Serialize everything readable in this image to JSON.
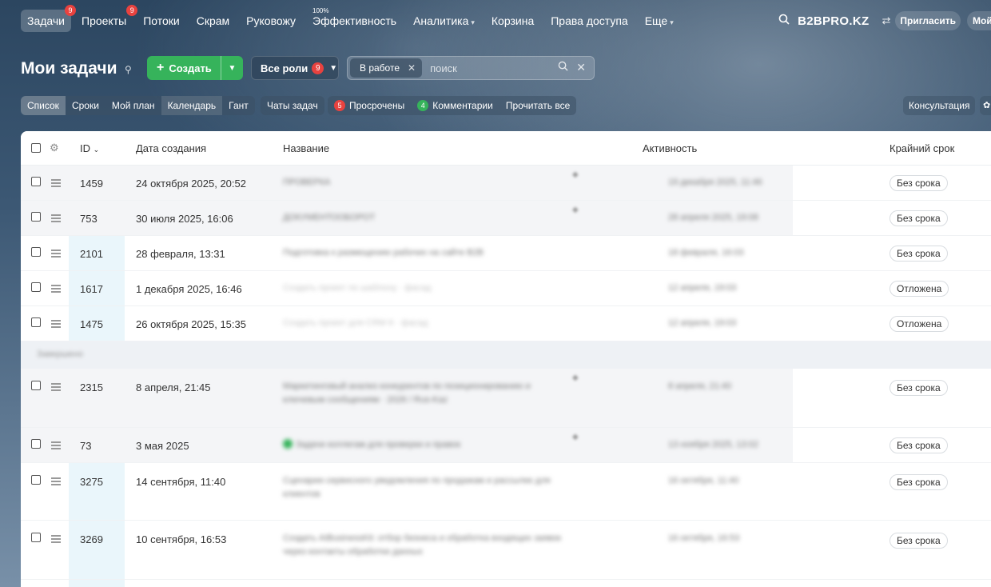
{
  "nav": {
    "items": [
      {
        "label": "Задачи",
        "badge": "9",
        "active": true
      },
      {
        "label": "Проекты",
        "badge": "9"
      },
      {
        "label": "Потоки"
      },
      {
        "label": "Скрам"
      },
      {
        "label": "Руковожу"
      },
      {
        "label": "Эффективность",
        "sup": "100%"
      },
      {
        "label": "Аналитика",
        "dropdown": true
      },
      {
        "label": "Корзина"
      },
      {
        "label": "Права доступа"
      },
      {
        "label": "Еще",
        "dropdown": true
      }
    ],
    "brand": "B2BPRO.KZ",
    "invite_label": "Пригласить",
    "my_label": "Мой"
  },
  "header": {
    "title": "Мои задачи",
    "create_label": "Создать",
    "roles_label": "Все роли",
    "roles_badge": "9",
    "filter_chip": "В работе",
    "search_placeholder": "поиск"
  },
  "toolbar": {
    "views": [
      "Список",
      "Сроки",
      "Мой план",
      "Календарь",
      "Гант"
    ],
    "active_view": "Список",
    "chats_label": "Чаты задач",
    "overdue_count": "5",
    "overdue_label": "Просрочены",
    "comments_count": "4",
    "comments_label": "Комментарии",
    "read_all_label": "Прочитать все",
    "consult_label": "Консультация"
  },
  "table": {
    "columns": {
      "id": "ID",
      "created": "Дата создания",
      "name": "Название",
      "activity": "Активность",
      "deadline": "Крайний срок"
    },
    "rows": [
      {
        "id": "1459",
        "created": "24 октября 2025, 20:52",
        "name": "ПРОВЕРКА",
        "activity": "19 декабря 2025, 11:46",
        "deadline": "Без срока"
      },
      {
        "id": "753",
        "created": "30 июля 2025, 16:06",
        "name": "ДОКУМЕНТООБОРОТ",
        "activity": "28 апреля 2025, 19:08",
        "deadline": "Без срока"
      },
      {
        "id": "2101",
        "created": "28 февраля, 13:31",
        "name": "Подготовка к размещению рабочих на сайте B2B",
        "activity": "18 февраля, 16:03",
        "deadline": "Без срока"
      },
      {
        "id": "1617",
        "created": "1 декабря 2025, 16:46",
        "name": "Создать проект по шаблону · фасад",
        "activity": "12 апреля, 19:03",
        "deadline": "Отложена"
      },
      {
        "id": "1475",
        "created": "26 октября 2025, 15:35",
        "name": "Создать проект для CRM 6 · фасад",
        "activity": "12 апреля, 19:03",
        "deadline": "Отложена"
      },
      {
        "id": "2315",
        "created": "8 апреля, 21:45",
        "name": "Маркетинговый анализ конкурентов по позиционированию и ключевым сообщениям · 2026 / Rus-Kaz",
        "activity": "8 апреля, 21:40",
        "deadline": "Без срока"
      },
      {
        "id": "73",
        "created": "3 мая 2025",
        "name": "Задачи коллегам для проверки и правок",
        "activity": "13 ноября 2025, 13:02",
        "deadline": "Без срока"
      },
      {
        "id": "3275",
        "created": "14 сентября, 11:40",
        "name": "Сценарии сервисного уведомления по продажам и рассылке для клиентов",
        "activity": "16 октября, 11:40",
        "deadline": "Без срока"
      },
      {
        "id": "3269",
        "created": "10 сентября, 16:53",
        "name": "Создать AIBusinessKit: отбор бизнеса и обработка входящих заявок через контакты обработки данных",
        "activity": "16 октября, 16:53",
        "deadline": "Без срока"
      }
    ],
    "group_label": "Завершено"
  },
  "colors": {
    "accent_green": "#36b35b",
    "badge_red": "#e8423f",
    "id_column": "#eaf6fb"
  }
}
